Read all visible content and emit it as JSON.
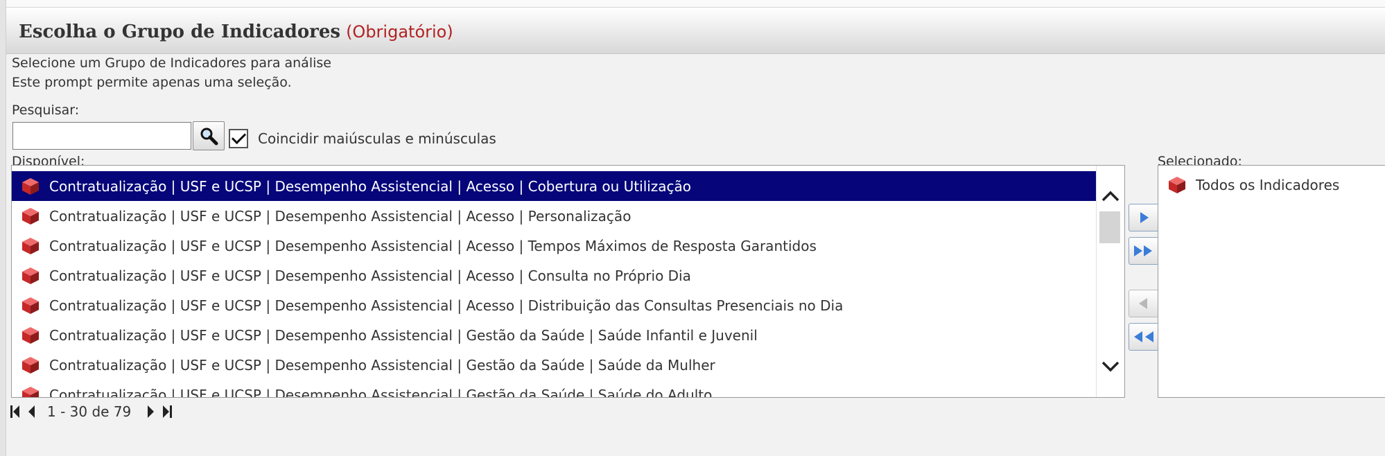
{
  "header": {
    "title": "Escolha o Grupo de Indicadores",
    "required": "(Obrigatório)"
  },
  "description": {
    "line1": "Selecione um Grupo de Indicadores para análise",
    "line2": "Este prompt permite apenas uma seleção."
  },
  "search": {
    "label": "Pesquisar:",
    "value": "",
    "match_case_label": "Coincidir maiúsculas e minúsculas",
    "match_case_checked": true
  },
  "available": {
    "label": "Disponível:",
    "items": [
      "Contratualização | USF e UCSP | Desempenho Assistencial | Acesso | Cobertura ou Utilização",
      "Contratualização | USF e UCSP | Desempenho Assistencial | Acesso | Personalização",
      "Contratualização | USF e UCSP | Desempenho Assistencial | Acesso | Tempos Máximos de Resposta Garantidos",
      "Contratualização | USF e UCSP | Desempenho Assistencial | Acesso | Consulta no Próprio Dia",
      "Contratualização | USF e UCSP | Desempenho Assistencial | Acesso | Distribuição das Consultas Presenciais no Dia",
      "Contratualização | USF e UCSP | Desempenho Assistencial | Gestão da Saúde | Saúde Infantil e Juvenil",
      "Contratualização | USF e UCSP | Desempenho Assistencial | Gestão da Saúde | Saúde da Mulher",
      "Contratualização | USF e UCSP | Desempenho Assistencial | Gestão da Saúde | Saúde do Adulto"
    ],
    "selected_index": 0
  },
  "selected": {
    "label": "Selecionado:",
    "items": [
      "Todos os Indicadores"
    ]
  },
  "pager": {
    "text": "1 - 30 de 79"
  },
  "colors": {
    "selection_bg": "#06067a",
    "required": "#b22222",
    "cube": "#c62828"
  },
  "icons": {
    "search": "magnifier-icon",
    "item": "cube-icon",
    "move_right": "arrow-right-icon",
    "move_all_right": "double-arrow-right-icon",
    "move_left": "arrow-left-icon",
    "move_all_left": "double-arrow-left-icon"
  }
}
